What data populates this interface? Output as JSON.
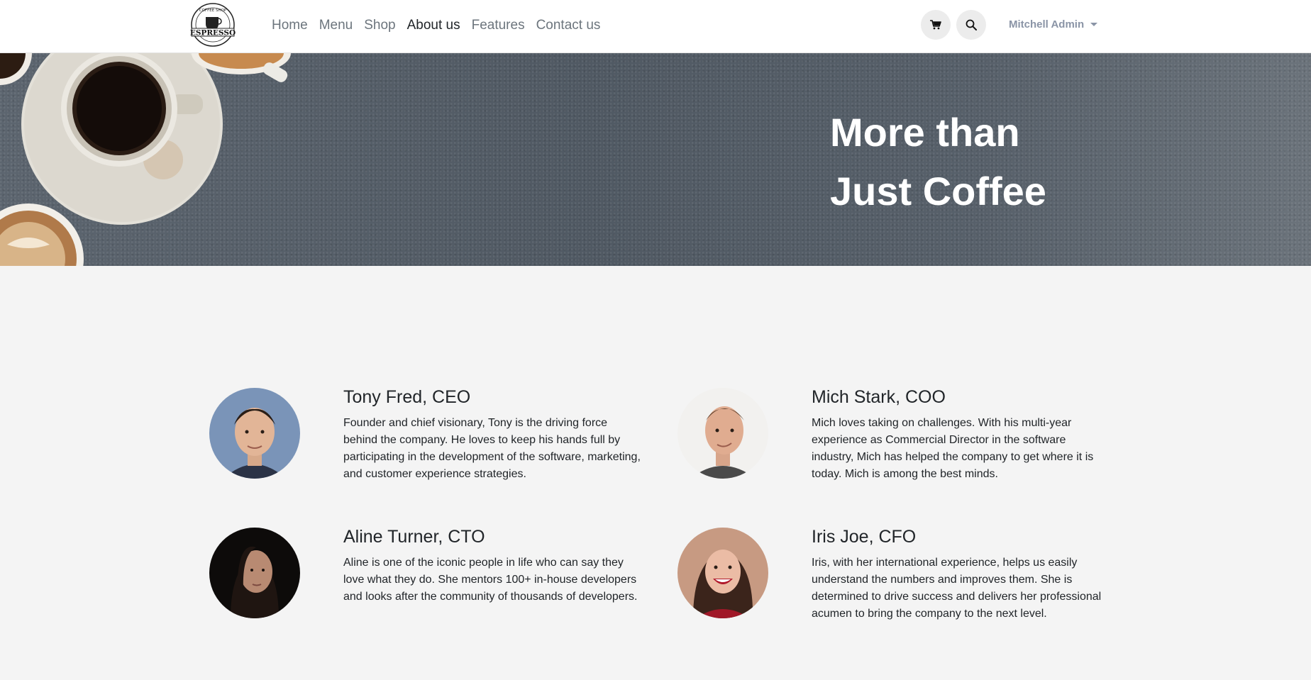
{
  "header": {
    "brand_name": "ESPRESSO",
    "brand_ring_text": "COFFEE SHOP",
    "nav": [
      {
        "label": "Home"
      },
      {
        "label": "Menu"
      },
      {
        "label": "Shop"
      },
      {
        "label": "About us",
        "active": true
      },
      {
        "label": "Features"
      },
      {
        "label": "Contact us"
      }
    ],
    "user_name": "Mitchell Admin",
    "cart_icon": "cart-icon",
    "search_icon": "search-icon"
  },
  "hero": {
    "title_line1": "More than",
    "title_line2": "Just Coffee"
  },
  "team": [
    {
      "name": "Tony Fred, CEO",
      "bio": "Founder and chief visionary, Tony is the driving force behind the company. He loves to keep his hands full by participating in the development of the software, marketing, and customer experience strategies."
    },
    {
      "name": "Mich Stark, COO",
      "bio": "Mich loves taking on challenges. With his multi-year experience as Commercial Director in the software industry, Mich has helped the company to get where it is today. Mich is among the best minds."
    },
    {
      "name": "Aline Turner, CTO",
      "bio": "Aline is one of the iconic people in life who can say they love what they do. She mentors 100+ in-house developers and looks after the community of thousands of developers."
    },
    {
      "name": "Iris Joe, CFO",
      "bio": "Iris, with her international experience, helps us easily understand the numbers and improves them. She is determined to drive success and delivers her professional acumen to bring the company to the next level."
    }
  ],
  "colors": {
    "header_bg": "#ffffff",
    "hero_bg": "#56606a",
    "page_bg": "#f4f4f4",
    "nav_text": "#6c757d",
    "nav_active": "#212529",
    "user_text": "#8a94a6"
  }
}
